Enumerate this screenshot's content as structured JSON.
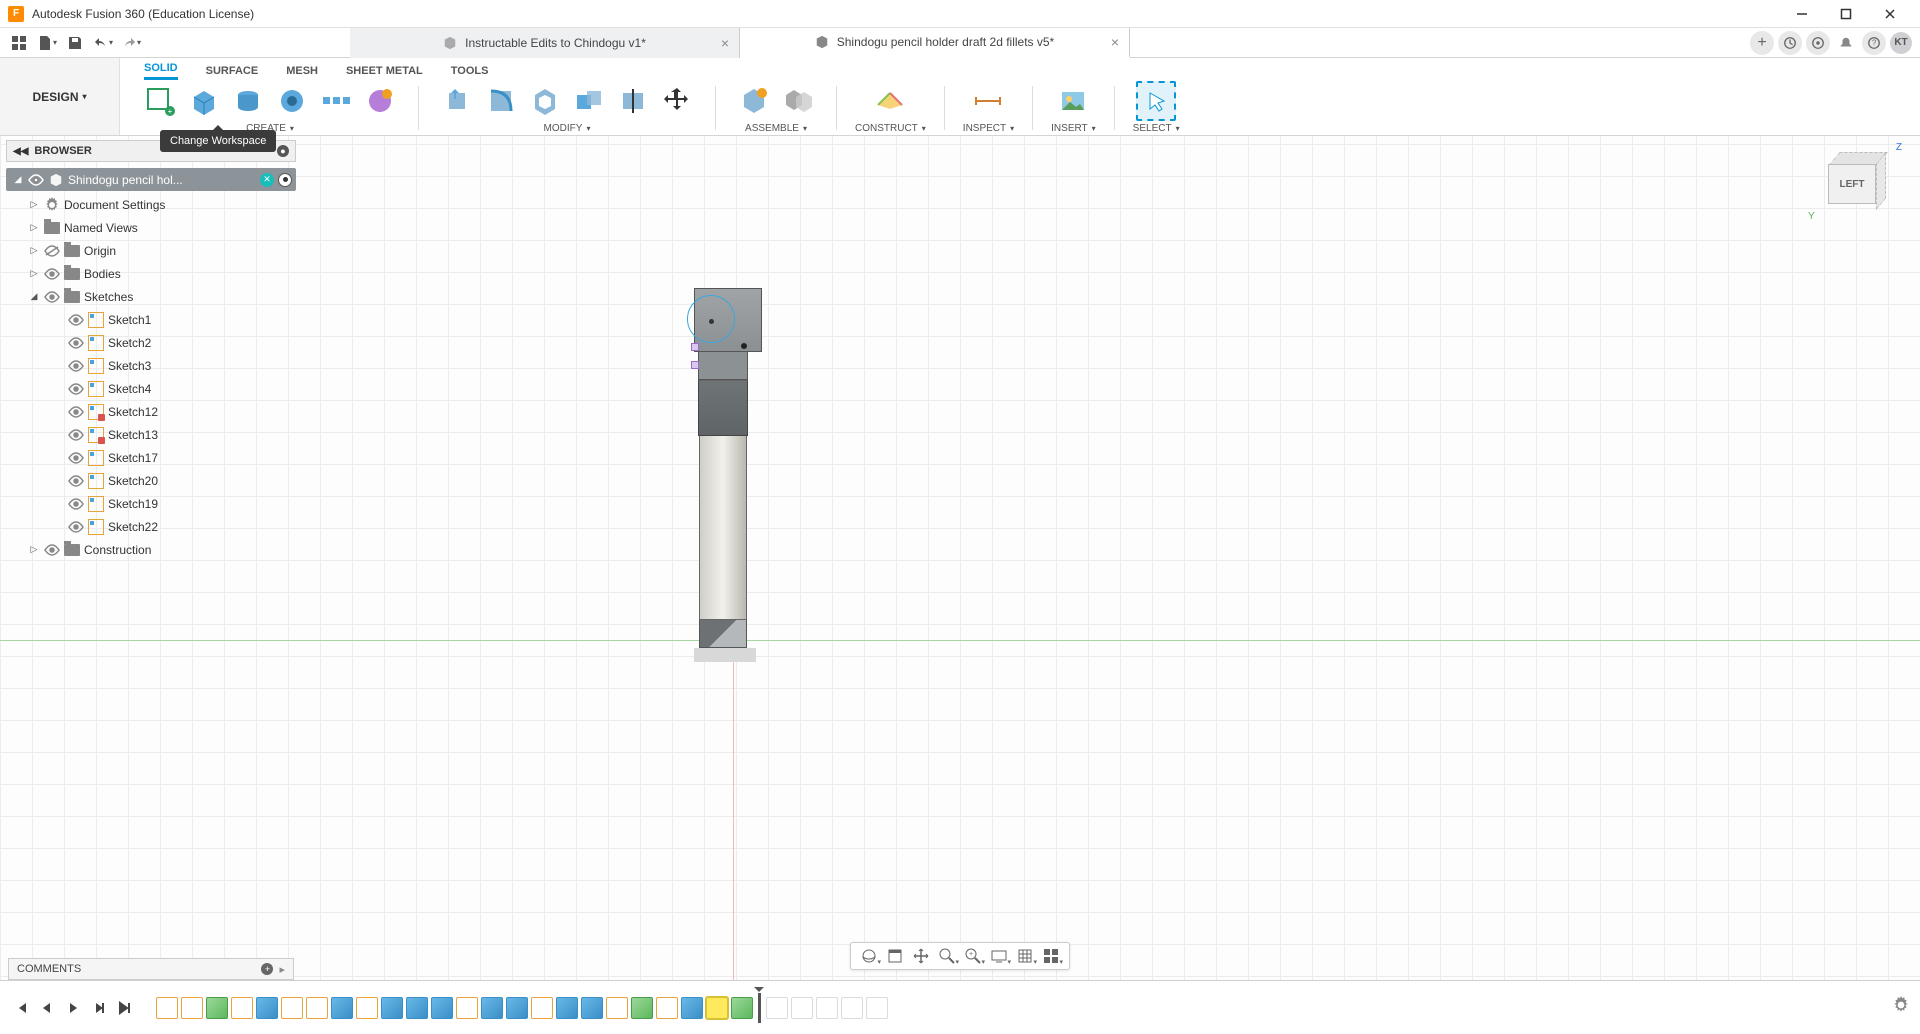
{
  "app": {
    "title": "Autodesk Fusion 360 (Education License)"
  },
  "tabs": {
    "items": [
      {
        "label": "Instructable Edits to Chindogu v1*",
        "active": false
      },
      {
        "label": "Shindogu pencil holder draft 2d fillets v5*",
        "active": true
      }
    ]
  },
  "avatar": "KT",
  "workspace_button": "DESIGN",
  "ribbon": {
    "tabs": [
      "SOLID",
      "SURFACE",
      "MESH",
      "SHEET METAL",
      "TOOLS"
    ],
    "active_tab": "SOLID",
    "groups": {
      "create": "CREATE",
      "modify": "MODIFY",
      "assemble": "ASSEMBLE",
      "construct": "CONSTRUCT",
      "inspect": "INSPECT",
      "insert": "INSERT",
      "select": "SELECT"
    }
  },
  "tooltip": "Change Workspace",
  "browser": {
    "title": "BROWSER",
    "root": "Shindogu pencil hol...",
    "nodes": {
      "doc_settings": "Document Settings",
      "named_views": "Named Views",
      "origin": "Origin",
      "bodies": "Bodies",
      "sketches": "Sketches",
      "construction": "Construction"
    },
    "sketches": [
      "Sketch1",
      "Sketch2",
      "Sketch3",
      "Sketch4",
      "Sketch12",
      "Sketch13",
      "Sketch17",
      "Sketch20",
      "Sketch19",
      "Sketch22"
    ]
  },
  "viewcube": {
    "face": "LEFT",
    "axis_z": "Z",
    "axis_y": "Y"
  },
  "comments": {
    "label": "COMMENTS"
  }
}
